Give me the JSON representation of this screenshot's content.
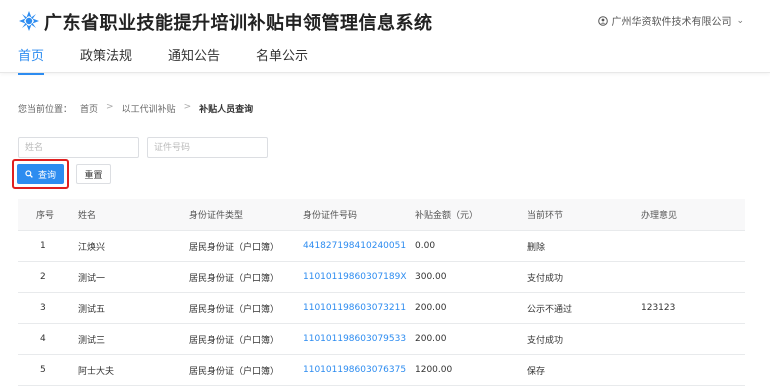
{
  "header": {
    "app_title": "广东省职业技能提升培训补贴申领管理信息系统",
    "company": "广州华资软件技术有限公司"
  },
  "nav": {
    "tabs": [
      {
        "label": "首页",
        "active": true
      },
      {
        "label": "政策法规",
        "active": false
      },
      {
        "label": "通知公告",
        "active": false
      },
      {
        "label": "名单公示",
        "active": false
      }
    ]
  },
  "breadcrumb": {
    "prefix": "您当前位置：",
    "items": [
      "首页",
      "以工代训补贴",
      "补贴人员查询"
    ]
  },
  "search": {
    "name_placeholder": "姓名",
    "name_value": "",
    "id_placeholder": "证件号码",
    "id_value": "",
    "search_label": "查询",
    "reset_label": "重置"
  },
  "colors": {
    "accent": "#2d8cf0",
    "highlight_border": "#e02020"
  },
  "table": {
    "headers": [
      "序号",
      "姓名",
      "身份证件类型",
      "身份证件号码",
      "补贴金额（元）",
      "当前环节",
      "办理意见"
    ],
    "rows": [
      [
        "1",
        "江焕兴",
        "居民身份证（户口簿）",
        "441827198410240051",
        "0.00",
        "删除",
        ""
      ],
      [
        "2",
        "测试一",
        "居民身份证（户口簿）",
        "11010119860307189X",
        "300.00",
        "支付成功",
        ""
      ],
      [
        "3",
        "测试五",
        "居民身份证（户口簿）",
        "110101198603073211",
        "200.00",
        "公示不通过",
        "123123"
      ],
      [
        "4",
        "测试三",
        "居民身份证（户口簿）",
        "110101198603079533",
        "200.00",
        "支付成功",
        ""
      ],
      [
        "5",
        "阿士大夫",
        "居民身份证（户口簿）",
        "110101198603076375",
        "1200.00",
        "保存",
        ""
      ]
    ]
  }
}
